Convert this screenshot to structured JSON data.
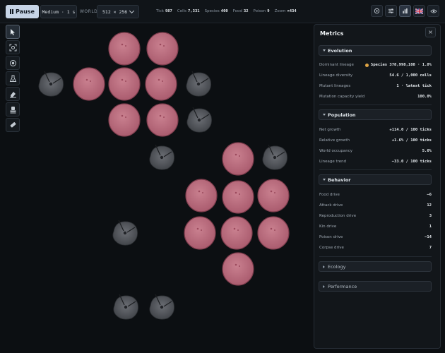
{
  "topbar": {
    "pause_label": "Pause",
    "speed_label": "Medium · 1 s",
    "world_label": "WORLD",
    "world_value": "512 × 256",
    "stats": [
      {
        "label": "Tick",
        "value": "987"
      },
      {
        "label": "Cells",
        "value": "7,331"
      },
      {
        "label": "Species",
        "value": "400"
      },
      {
        "label": "Food",
        "value": "32"
      },
      {
        "label": "Poison",
        "value": "9"
      },
      {
        "label": "Zoom",
        "value": "×434"
      }
    ],
    "icons": [
      "target-icon",
      "sliders-icon",
      "bar-chart-icon",
      "uk-flag-icon",
      "eye-icon"
    ]
  },
  "tools": [
    "pointer-icon",
    "focus-icon",
    "spawn-cell-icon",
    "spawn-flask-icon",
    "erase-icon",
    "stamp-icon",
    "eraser-icon"
  ],
  "colors": {
    "cell_fill": "#c27385",
    "organism": "#5a5d63",
    "accent": "#e0a545"
  },
  "metrics": {
    "title": "Metrics",
    "close": "×",
    "evolution": {
      "title": "Evolution",
      "rows": [
        {
          "label": "Dominant lineage",
          "value": "Species 378,998,108 · 1.8%"
        },
        {
          "label": "Lineage diversity",
          "value": "54.6 / 1,000 cells"
        },
        {
          "label": "Mutant lineages",
          "value": "1 · latest tick"
        },
        {
          "label": "Mutation capacity yield",
          "value": "100.0%"
        }
      ]
    },
    "population": {
      "title": "Population",
      "rows": [
        {
          "label": "Net growth",
          "value": "+114.0 / 100 ticks"
        },
        {
          "label": "Relative growth",
          "value": "+1.6% / 100 ticks"
        },
        {
          "label": "World occupancy",
          "value": "5.6%"
        },
        {
          "label": "Lineage trend",
          "value": "−33.0 / 100 ticks"
        }
      ]
    },
    "behavior": {
      "title": "Behavior",
      "rows": [
        {
          "label": "Food drive",
          "value": "−6"
        },
        {
          "label": "Attack drive",
          "value": "12"
        },
        {
          "label": "Reproduction drive",
          "value": "3"
        },
        {
          "label": "Kin drive",
          "value": "1"
        },
        {
          "label": "Poison drive",
          "value": "−14"
        },
        {
          "label": "Corpse drive",
          "value": "7"
        }
      ]
    },
    "ecology": {
      "title": "Ecology"
    },
    "performance": {
      "title": "Performance"
    }
  }
}
